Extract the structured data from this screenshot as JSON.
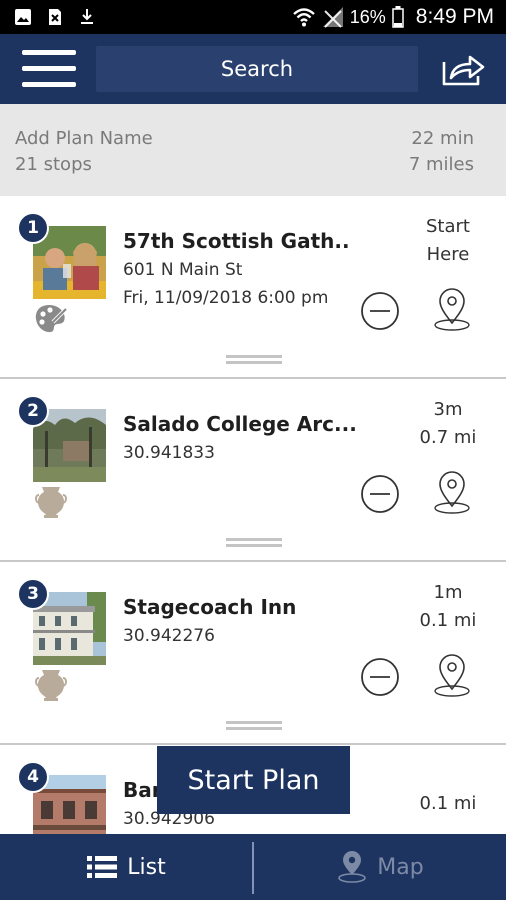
{
  "status_bar": {
    "battery": "16%",
    "time": "8:49 PM",
    "left_icons": [
      "image-icon",
      "file-icon",
      "download-icon"
    ],
    "right_icons": [
      "wifi-icon",
      "no-signal-icon",
      "battery-icon"
    ]
  },
  "header": {
    "search_label": "Search",
    "menu_icon": "hamburger-menu-icon",
    "share_icon": "share-icon",
    "background": "#1e3460"
  },
  "plan": {
    "name_placeholder": "Add Plan Name",
    "stops": "21 stops",
    "duration": "22 min",
    "distance": "7 miles"
  },
  "stops": [
    {
      "number": "1",
      "title": "57th Scottish Gath..",
      "line1": "601 N Main St",
      "line2": "Fri, 11/09/2018 6:00 pm",
      "time": "Start",
      "dist": "Here",
      "category_icon": "arts-palette-icon"
    },
    {
      "number": "2",
      "title": "Salado College Arc...",
      "line1": "30.941833",
      "line2": "",
      "time": "3m",
      "dist": "0.7 mi",
      "category_icon": "historic-vase-icon"
    },
    {
      "number": "3",
      "title": "Stagecoach Inn",
      "line1": "30.942276",
      "line2": "",
      "time": "1m",
      "dist": "0.1 mi",
      "category_icon": "historic-vase-icon"
    },
    {
      "number": "4",
      "title": "Bar",
      "line1": "30.942906",
      "line2": "",
      "time": "",
      "dist": "0.1 mi",
      "category_icon": "historic-vase-icon"
    }
  ],
  "start_plan_label": "Start Plan",
  "bottom_nav": {
    "list_label": "List",
    "map_label": "Map",
    "active": "List"
  }
}
